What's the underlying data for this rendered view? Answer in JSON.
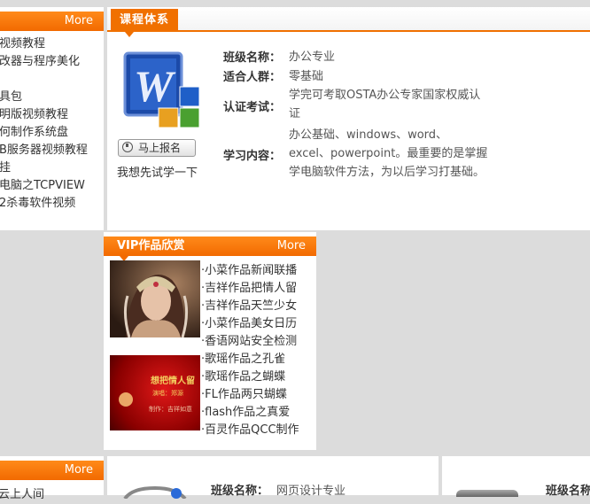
{
  "left_panel_top": {
    "more": "More",
    "items": [
      "视频教程",
      "改器与程序美化",
      "",
      "具包",
      "明版视频教程",
      "何制作系统盘",
      "B服务器视频教程",
      "挂",
      "电脑之TCPVIEW",
      "2杀毒软件视频"
    ]
  },
  "course": {
    "tab": "课程体系",
    "sign_button": "马上报名",
    "try_link": "我想先试学一下",
    "rows": [
      {
        "label": "班级名称：",
        "value": "办公专业"
      },
      {
        "label": "适合人群：",
        "value": "零基础"
      },
      {
        "label": "认证考试：",
        "value": "学完可考取OSTA办公专家国家权威认证"
      },
      {
        "label": "学习内容：",
        "value": "办公基础、windows、word、excel、powerpoint。最重要的是掌握学电脑软件方法，为以后学习打基础。"
      }
    ]
  },
  "vip": {
    "title": "VIP作品欣赏",
    "more": "More",
    "items": [
      "·小菜作品新闻联播",
      "·吉祥作品把情人留",
      "·吉祥作品天竺少女",
      "·小菜作品美女日历",
      "·香语网站安全检测",
      "·歌瑶作品之孔雀",
      "·歌瑶作品之蝴蝶",
      "·FL作品两只蝴蝶",
      "·flash作品之真爱",
      "·百灵作品QCC制作"
    ],
    "thumb2_title": "想把情人留",
    "thumb2_sub1": "演唱：郑源",
    "thumb2_sub2": "制作：吉祥如意"
  },
  "bottom": {
    "left_more": "More",
    "left_item": "云上人间",
    "mid_label": "班级名称：",
    "mid_value": "网页设计专业",
    "right_label": "班级名称"
  },
  "colors": {
    "accent": "#f07000",
    "background": "#dcdcdc"
  }
}
